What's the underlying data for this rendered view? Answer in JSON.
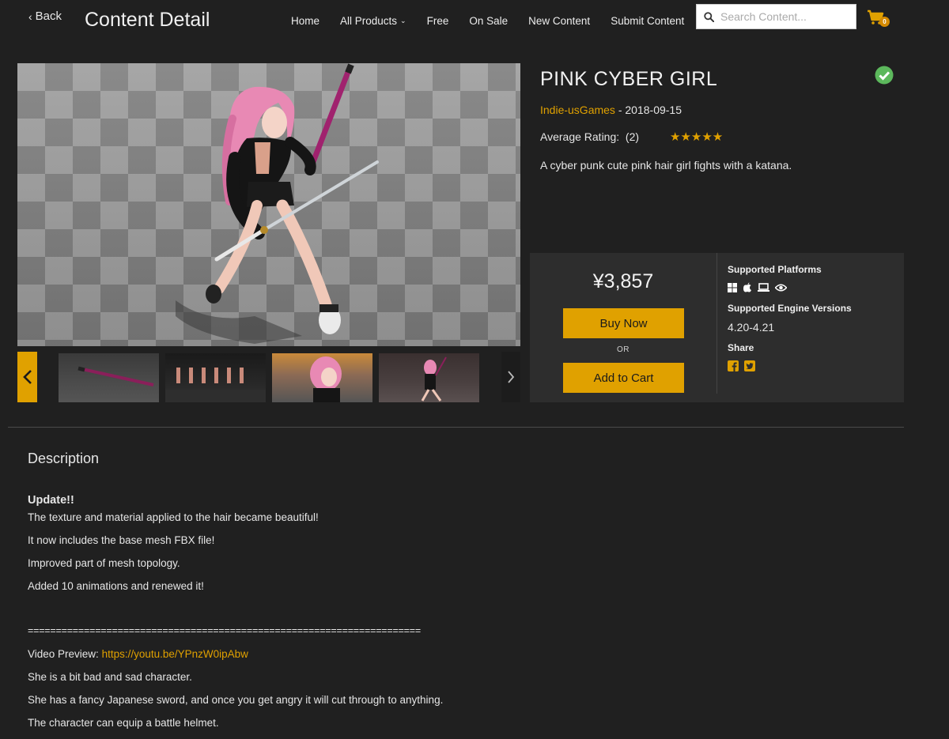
{
  "header": {
    "back_label": "Back",
    "page_title": "Content Detail",
    "nav": [
      {
        "label": "Home"
      },
      {
        "label": "All Products",
        "has_dropdown": true
      },
      {
        "label": "Free"
      },
      {
        "label": "On Sale"
      },
      {
        "label": "New Content"
      },
      {
        "label": "Submit Content"
      }
    ],
    "search_placeholder": "Search Content...",
    "cart_count": "0"
  },
  "product": {
    "title": "PINK CYBER GIRL",
    "author": "Indie-usGames",
    "date_sep": " - ",
    "date": "2018-09-15",
    "rating_label": "Average Rating:",
    "rating_count": "(2)",
    "stars": "★★★★★",
    "rating_value": 5,
    "short_description": "A cyber punk cute pink hair girl fights with a katana."
  },
  "purchase": {
    "price": "¥3,857",
    "buy_label": "Buy Now",
    "or_label": "OR",
    "add_to_cart_label": "Add to Cart",
    "supported_platforms_label": "Supported Platforms",
    "platform_icons": [
      "windows-icon",
      "apple-icon",
      "laptop-icon",
      "eye-icon"
    ],
    "engine_versions_label": "Supported Engine Versions",
    "engine_versions": "4.20-4.21",
    "share_label": "Share",
    "share_icons": [
      "facebook-icon",
      "twitter-icon"
    ]
  },
  "description": {
    "heading": "Description",
    "update_title": "Update!!",
    "lines": [
      "The texture and material applied to the hair became beautiful!",
      "It now includes the base mesh FBX file!",
      "Improved part of mesh topology.",
      "Added 10 animations and renewed it!"
    ],
    "separator": "======================================================================",
    "video_label": "Video Preview: ",
    "video_link": "https://youtu.be/YPnzW0ipAbw",
    "lines2": [
      "She is a bit bad and sad character.",
      "She has a fancy Japanese sword, and once you get angry it will cut through to anything.",
      "The character can equip a battle helmet."
    ]
  },
  "colors": {
    "accent": "#e0a100",
    "background": "#202020",
    "panel": "#2d2d2d",
    "verified": "#5cb85c"
  }
}
